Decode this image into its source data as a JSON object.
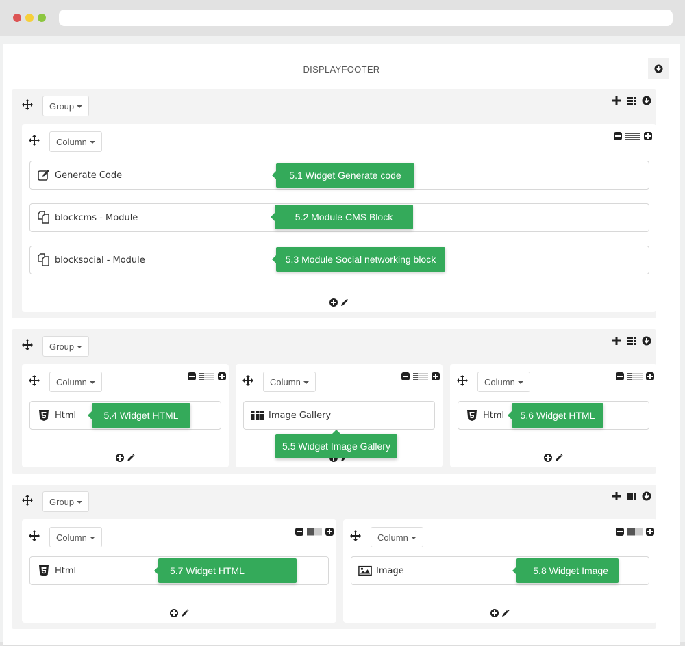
{
  "window": {
    "title": ""
  },
  "panel": {
    "title": "DISPLAYFOOTER",
    "collapse_icon": "arrow-circle-down-icon"
  },
  "groups": [
    {
      "label": "Group",
      "tools": [
        "plus-icon",
        "grid-icon",
        "arrow-circle-down-icon"
      ],
      "columns": [
        {
          "label": "Column",
          "width_fraction": "12/12",
          "widgets": [
            {
              "icon": "edit-icon",
              "label": "Generate Code",
              "tip": "5.1 Widget Generate code"
            },
            {
              "icon": "copy-icon",
              "label": "blockcms - Module",
              "tip": "5.2 Module CMS Block"
            },
            {
              "icon": "copy-icon",
              "label": "blocksocial - Module",
              "tip": "5.3 Module Social networking block"
            }
          ]
        }
      ]
    },
    {
      "label": "Group",
      "tools": [
        "plus-icon",
        "grid-icon",
        "arrow-circle-down-icon"
      ],
      "columns": [
        {
          "label": "Column",
          "width_fraction": "4/12",
          "widgets": [
            {
              "icon": "html5-icon",
              "label": "Html",
              "tip": "5.4 Widget HTML"
            }
          ]
        },
        {
          "label": "Column",
          "width_fraction": "4/12",
          "widgets": [
            {
              "icon": "th-icon",
              "label": "Image Gallery",
              "tip": "5.5 Widget Image Gallery"
            }
          ]
        },
        {
          "label": "Column",
          "width_fraction": "4/12",
          "widgets": [
            {
              "icon": "html5-icon",
              "label": "Html",
              "tip": "5.6 Widget HTML"
            }
          ]
        }
      ]
    },
    {
      "label": "Group",
      "tools": [
        "plus-icon",
        "grid-icon",
        "arrow-circle-down-icon"
      ],
      "columns": [
        {
          "label": "Column",
          "width_fraction": "6/12",
          "widgets": [
            {
              "icon": "html5-icon",
              "label": "Html",
              "tip": "5.7 Widget HTML"
            }
          ]
        },
        {
          "label": "Column",
          "width_fraction": "6/12",
          "widgets": [
            {
              "icon": "picture-icon",
              "label": "Image",
              "tip": "5.8 Widget Image"
            }
          ]
        }
      ]
    }
  ],
  "colors": {
    "accent_green": "#34aa5a",
    "group_bg": "#f3f3f3",
    "icon_dark": "#222222"
  }
}
